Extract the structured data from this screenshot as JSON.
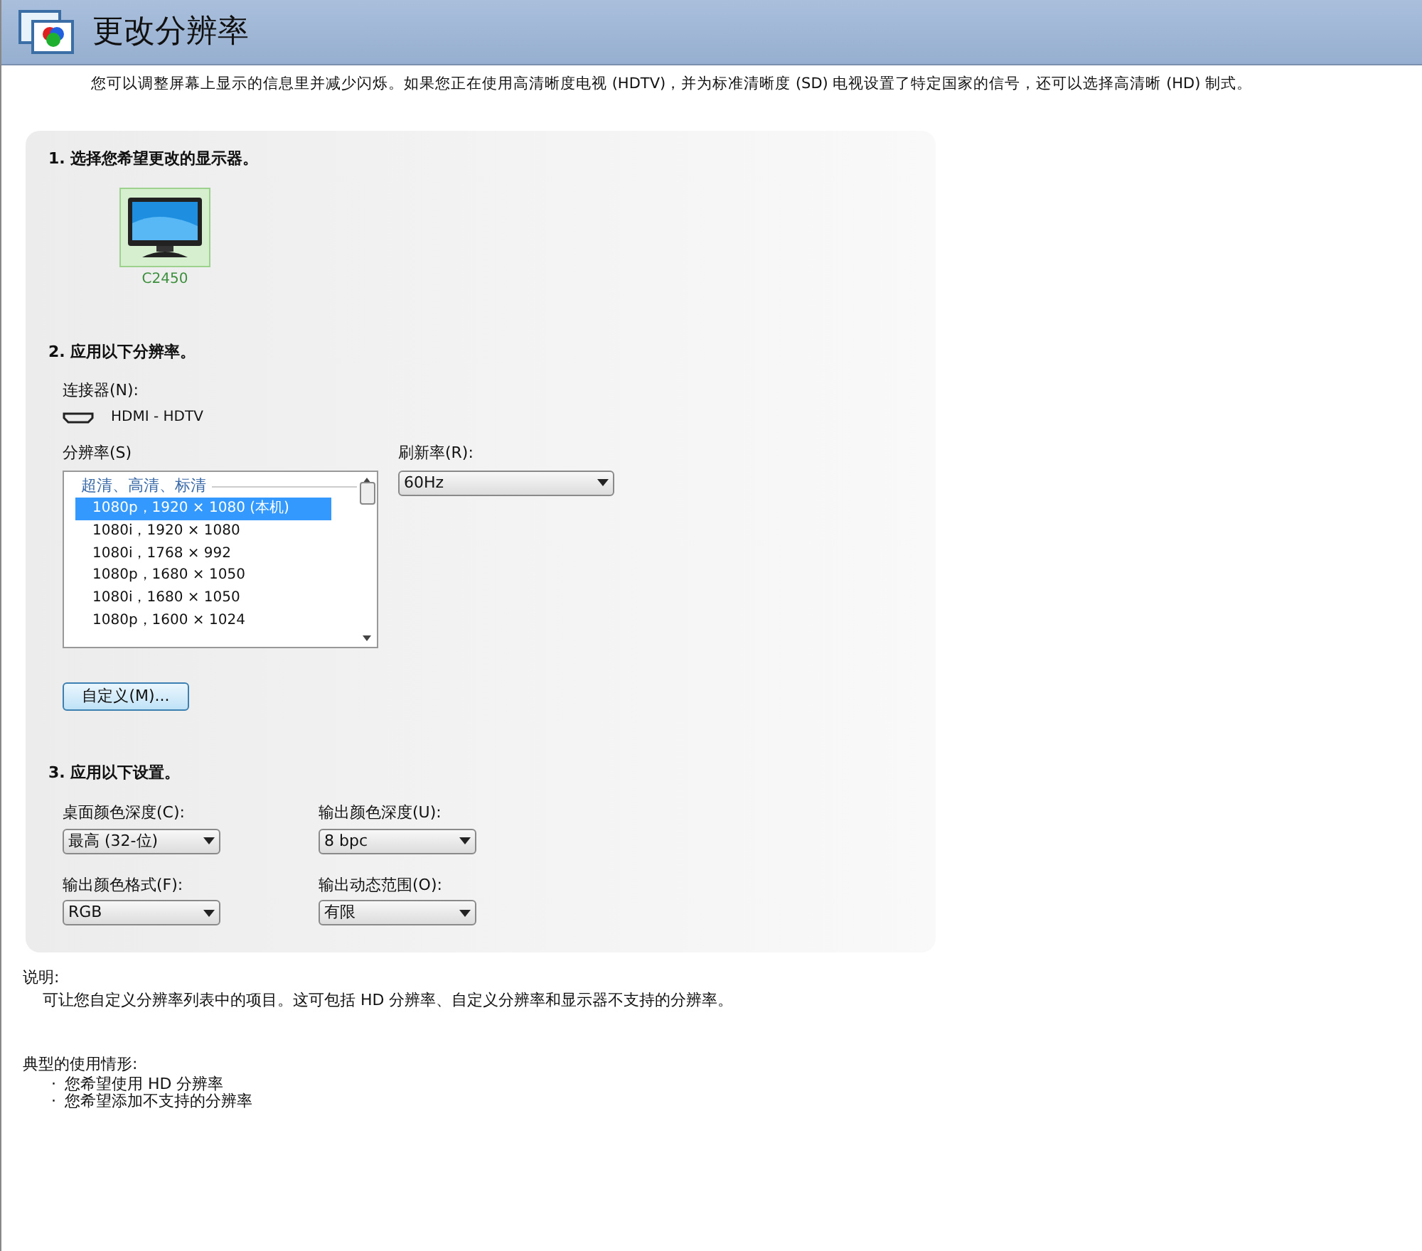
{
  "header": {
    "title": "更改分辨率"
  },
  "intro": "您可以调整屏幕上显示的信息里并减少闪烁。如果您正在使用高清晰度电视 (HDTV)，并为标准清晰度 (SD) 电视设置了特定国家的信号，还可以选择高清晰 (HD) 制式。",
  "section1": {
    "title": "1. 选择您希望更改的显示器。",
    "displays": [
      {
        "name": "C2450",
        "selected": true
      }
    ]
  },
  "section2": {
    "title": "2. 应用以下分辨率。",
    "connector_label": "连接器(N):",
    "connector": "HDMI - HDTV",
    "resolution_label": "分辨率(S)",
    "resolution_group": "超清、高清、标清",
    "resolutions": [
      {
        "label": "1080p，1920 × 1080 (本机)",
        "selected": true
      },
      {
        "label": "1080i，1920 × 1080",
        "selected": false
      },
      {
        "label": "1080i，1768 × 992",
        "selected": false
      },
      {
        "label": "1080p，1680 × 1050",
        "selected": false
      },
      {
        "label": "1080i，1680 × 1050",
        "selected": false
      },
      {
        "label": "1080p，1600 × 1024",
        "selected": false
      }
    ],
    "refresh_label": "刷新率(R):",
    "refresh_value": "60Hz",
    "custom_button": "自定义(M)..."
  },
  "section3": {
    "title": "3. 应用以下设置。",
    "settings": [
      {
        "label": "桌面颜色深度(C):",
        "value": "最高 (32-位)"
      },
      {
        "label": "输出颜色深度(U):",
        "value": "8 bpc"
      },
      {
        "label": "输出颜色格式(F):",
        "value": "RGB"
      },
      {
        "label": "输出动态范围(O):",
        "value": "有限"
      }
    ]
  },
  "description": {
    "title": "说明:",
    "text": "可让您自定义分辨率列表中的项目。这可包括 HD 分辨率、自定义分辨率和显示器不支持的分辨率。"
  },
  "usage": {
    "title": "典型的使用情形:",
    "bullet": "·",
    "items": [
      "您希望使用 HD 分辨率",
      "您希望添加不支持的分辨率"
    ]
  }
}
